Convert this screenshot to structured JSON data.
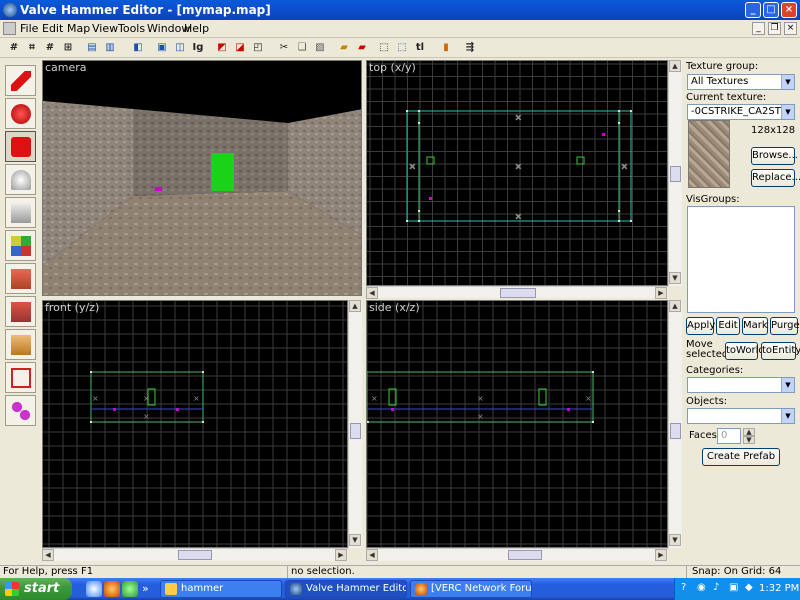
{
  "window": {
    "title": "Valve Hammer Editor - [mymap.map]",
    "min": "_",
    "max": "□",
    "close": "×"
  },
  "menu": [
    "File",
    "Edit",
    "Map",
    "View",
    "Tools",
    "Window",
    "Help"
  ],
  "mdi": {
    "min": "_",
    "restore": "❐",
    "close": "×"
  },
  "toolbar": [
    "grid-toggle-icon",
    "3d-grid-icon",
    "grid-larger-icon",
    "grid-smaller-icon",
    "load-window-state-icon",
    "save-window-state-icon",
    "carve-icon",
    "group-icon",
    "ungroup-icon",
    "ignore-groups-icon",
    "hide-selected-icon",
    "show-selected-icon",
    "show-all-icon",
    "cut-icon",
    "copy-icon",
    "paste-icon",
    "texture-lock-icon",
    "texture-scale-icon",
    "toggle-handles-icon",
    "toggle-selection-icon",
    "toggle-texture-lock-icon",
    "cordon-icon",
    "run-map-icon"
  ],
  "tools": [
    "selection-tool",
    "magnify-tool",
    "camera-tool",
    "entity-tool",
    "block-tool",
    "texture-application-tool",
    "apply-current-texture-tool",
    "decal-tool",
    "clipping-tool",
    "vertex-manipulation-tool",
    "path-tool"
  ],
  "viewports": {
    "camera": "camera",
    "top": "top (x/y)",
    "front": "front (y/z)",
    "side": "side (x/z)"
  },
  "panel": {
    "texture_group_label": "Texture group:",
    "texture_group": "All Textures",
    "current_texture_label": "Current texture:",
    "current_texture": "-0CSTRIKE_CA2ST",
    "texture_size": "128x128",
    "browse": "Browse...",
    "replace": "Replace...",
    "visgroups_label": "VisGroups:",
    "apply": "Apply",
    "edit": "Edit",
    "mark": "Mark",
    "purge": "Purge",
    "move_selected_label": "Move selected:",
    "to_world": "toWorld",
    "to_entity": "toEntity",
    "categories_label": "Categories:",
    "categories": "",
    "objects_label": "Objects:",
    "objects": "",
    "faces_label": "Faces:",
    "faces_value": "0",
    "create_prefab": "Create Prefab"
  },
  "status": {
    "help": "For Help, press F1",
    "selection": "no selection.",
    "snap": "Snap: On Grid: 64"
  },
  "taskbar": {
    "start": "start",
    "tasks": [
      "hammer",
      "Valve Hammer Editor ...",
      "[VERC Network Foru..."
    ],
    "quicklaunch_more": "»",
    "time": "1:32 PM"
  }
}
